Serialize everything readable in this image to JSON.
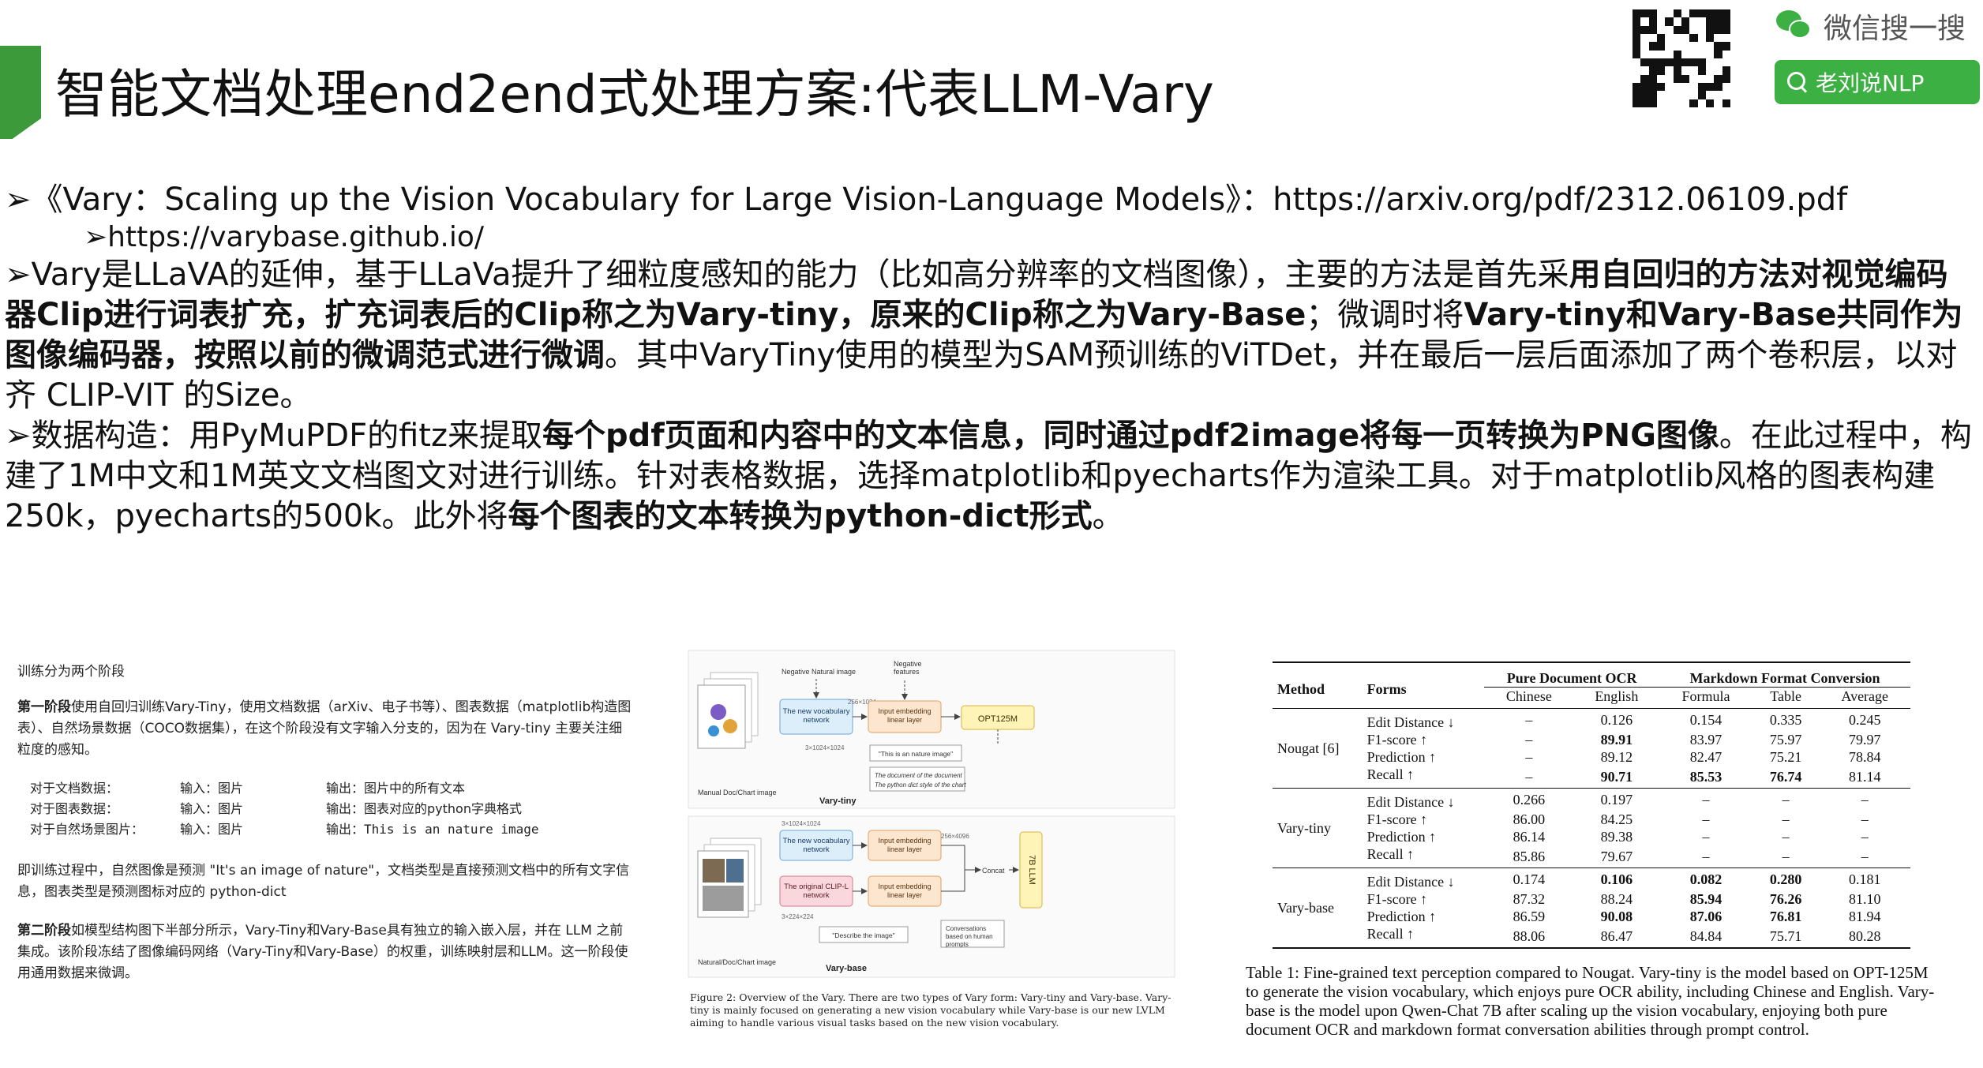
{
  "header": {
    "title": "智能文档处理end2end式处理方案:代表LLM-Vary",
    "wechat_label": "微信搜一搜",
    "search_label": "老刘说NLP"
  },
  "colors": {
    "accent": "#3c9a3a",
    "wechat_green": "#3cb043"
  },
  "content": {
    "line1": "《Vary：Scaling up the Vision Vocabulary for Large Vision-Language Models》：https://arxiv.org/pdf/2312.06109.pdf",
    "line2": "https://varybase.github.io/",
    "p1_a": "Vary是LLaVA的延伸，基于LLaVa提升了细粒度感知的能力（比如高分辨率的文档图像），主要的方法是首先采",
    "p1_b": "用自回归的方法对视觉编码器Clip进行词表扩充，扩充词表后的Clip称之为Vary-tiny，原来的Clip称之为Vary-Base",
    "p1_c": "；微调时将",
    "p1_d": "Vary-tiny和Vary-Base共同作为图像编码器，按照以前的微调范式进行微调",
    "p1_e": "。其中VaryTiny使用的模型为SAM预训练的ViTDet，并在最后一层后面添加了两个卷积层，以对齐 CLIP-VIT 的Size。",
    "p2_a": "数据构造：用PyMuPDF的fitz来提取",
    "p2_b": "每个pdf页面和内容中的文本信息，同时通过pdf2image将每一页转换为PNG图像",
    "p2_c": "。在此过程中，构建了1M中文和1M英文文档图文对进行训练。针对表格数据，选择matplotlib和pyecharts作为渲染工具。对于matplotlib风格的图表构建250k，pyecharts的500k。此外将",
    "p2_d": "每个图表的文本转换为python-dict形式",
    "p2_e": "。"
  },
  "left_panel": {
    "heading": "训练分为两个阶段",
    "stage1_bold": "第一阶段",
    "stage1_text": "使用自回归训练Vary-Tiny，使用文档数据（arXiv、电子书等）、图表数据（matplotlib构造图表）、自然场景数据（COCO数据集），在这个阶段没有文字输入分支的，因为在 Vary-tiny 主要关注细粒度的感知。",
    "io_rows": [
      [
        "对于文档数据：",
        "输入：图片",
        "输出：图片中的所有文本"
      ],
      [
        "对于图表数据：",
        "输入：图片",
        "输出：图表对应的python字典格式"
      ],
      [
        "对于自然场景图片：",
        "输入：图片",
        "输出：This is an nature image"
      ]
    ],
    "note": "即训练过程中，自然图像是预测 \"It's an image of nature\"，文档类型是直接预测文档中的所有文字信息，图表类型是预测图标对应的 python-dict",
    "stage2_bold": "第二阶段",
    "stage2_text": "如模型结构图下半部分所示，Vary-Tiny和Vary-Base具有独立的输入嵌入层，并在 LLM 之前集成。该阶段冻结了图像编码网络（Vary-Tiny和Vary-Base）的权重，训练映射层和LLM。这一阶段使用通用数据来微调。"
  },
  "figure": {
    "neg_natural": "Negative Natural image",
    "neg_features": "Negative features",
    "new_vocab_1": "The new vocabulary network",
    "embed_1": "Input embedding linear layer",
    "opt": "OPT125M",
    "nature_prompt": "\"This is an nature image\"",
    "manual_doc": "Manual Doc/Chart image",
    "vary_tiny": "Vary-tiny",
    "doc_text": "The document of the document",
    "chart_text": "The python dict style of the chart",
    "new_vocab_2": "The new vocabulary network",
    "clip": "The original CLIP-L network",
    "embed_2": "Input embedding linear layer",
    "embed_3": "Input embedding linear layer",
    "concat": "Concat",
    "llm": "7B LLM",
    "describe": "\"Describe the image\"",
    "conversation": "Conversations based on human prompts",
    "natural_doc": "Natural/Doc/Chart image",
    "vary_base": "Vary-base",
    "dim_a": "256×1024",
    "dim_b": "3×1024×1024",
    "dim_c": "256×4096",
    "dim_d": "3×224×224",
    "caption": "Figure 2: Overview of the Vary. There are two types of Vary form: Vary-tiny and Vary-base. Vary-tiny is mainly focused on generating a new vision vocabulary while Vary-base is our new LVLM aiming to handle various visual tasks based on the new vision vocabulary."
  },
  "results_table": {
    "h_method": "Method",
    "h_forms": "Forms",
    "h_pure": "Pure Document OCR",
    "h_markdown": "Markdown Format Conversion",
    "h_cols": [
      "Chinese",
      "English",
      "Formula",
      "Table",
      "Average"
    ],
    "forms": [
      "Edit Distance ↓",
      "F1-score ↑",
      "Prediction ↑",
      "Recall ↑"
    ],
    "methods": [
      "Nougat [6]",
      "Vary-tiny",
      "Vary-base"
    ],
    "nougat": [
      [
        "–",
        "0.126",
        "0.154",
        "0.335",
        "0.245"
      ],
      [
        "–",
        "89.91",
        "83.97",
        "75.97",
        "79.97"
      ],
      [
        "–",
        "89.12",
        "82.47",
        "75.21",
        "78.84"
      ],
      [
        "–",
        "90.71",
        "85.53",
        "76.74",
        "81.14"
      ]
    ],
    "tiny": [
      [
        "0.266",
        "0.197",
        "–",
        "–",
        "–"
      ],
      [
        "86.00",
        "84.25",
        "–",
        "–",
        "–"
      ],
      [
        "86.14",
        "89.38",
        "–",
        "–",
        "–"
      ],
      [
        "85.86",
        "79.67",
        "–",
        "–",
        "–"
      ]
    ],
    "base": [
      [
        "0.174",
        "0.106",
        "0.082",
        "0.280",
        "0.181"
      ],
      [
        "87.32",
        "88.24",
        "85.94",
        "76.26",
        "81.10"
      ],
      [
        "86.59",
        "90.08",
        "87.06",
        "76.81",
        "81.94"
      ],
      [
        "88.06",
        "86.47",
        "84.84",
        "75.71",
        "80.28"
      ]
    ],
    "caption": "Table 1: Fine-grained text perception compared to Nougat. Vary-tiny is the model based on OPT-125M to generate the vision vocabulary, which enjoys pure OCR ability, including Chinese and English. Vary-base is the model upon Qwen-Chat 7B after scaling up the vision vocabulary, enjoying both pure document OCR and markdown format conversation abilities through prompt control."
  }
}
